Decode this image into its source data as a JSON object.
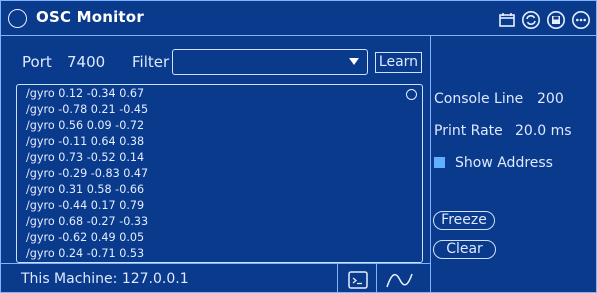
{
  "window": {
    "title": "OSC Monitor"
  },
  "toolbar": {
    "port_label": "Port",
    "port_value": "7400",
    "filter_label": "Filter",
    "filter_value": "",
    "learn_label": "Learn"
  },
  "console": {
    "lines": [
      "/gyro 0.12 -0.34 0.67",
      "/gyro -0.78 0.21 -0.45",
      "/gyro 0.56 0.09 -0.72",
      "/gyro -0.11 0.64 0.38",
      "/gyro 0.73 -0.52 0.14",
      "/gyro -0.29 -0.83 0.47",
      "/gyro 0.31 0.58 -0.66",
      "/gyro -0.44 0.17 0.79",
      "/gyro 0.68 -0.27 -0.33",
      "/gyro -0.62 0.49 0.05",
      "/gyro 0.24 -0.71 0.53"
    ]
  },
  "settings": {
    "console_line_label": "Console Line",
    "console_line_value": "200",
    "print_rate_label": "Print Rate",
    "print_rate_value": "20.0 ms",
    "show_address_label": "Show Address",
    "show_address_checked": true
  },
  "actions": {
    "freeze_label": "Freeze",
    "clear_label": "Clear"
  },
  "status": {
    "machine_text": "This Machine: 127.0.0.1"
  },
  "icons": {
    "title_icons": [
      "window-icon",
      "sync-icon",
      "save-icon",
      "more-icon"
    ],
    "bottom_icons": [
      "terminal-icon",
      "waveform-icon"
    ]
  },
  "colors": {
    "background": "#0a3a8c",
    "line": "#7fb3ff",
    "text": "#dfe9ff",
    "accent": "#5fb0ff"
  }
}
